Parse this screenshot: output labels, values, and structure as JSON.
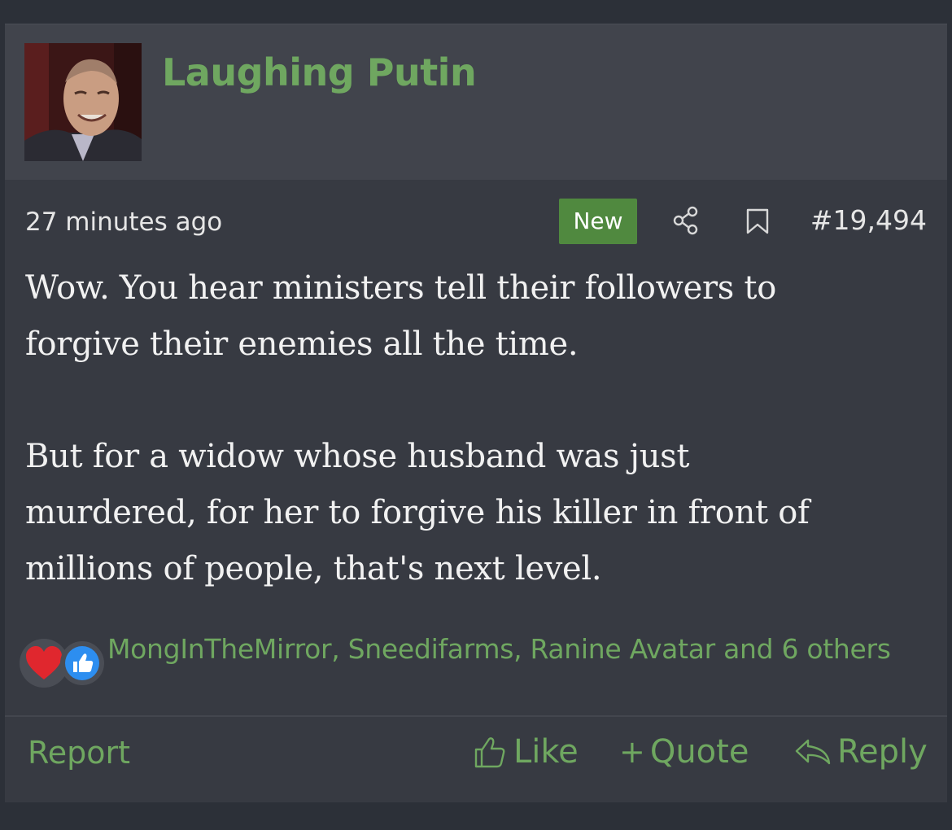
{
  "user": {
    "name": "Laughing Putin",
    "avatar_icon": "user-avatar-photo"
  },
  "meta": {
    "timestamp": "27 minutes ago",
    "badge": "New",
    "post_number": "#19,494",
    "share_icon": "share-icon",
    "bookmark_icon": "bookmark-icon"
  },
  "message": {
    "paragraph1": [
      "Wow. You hear ministers tell their followers to",
      "forgive their enemies all the time."
    ],
    "paragraph2": [
      "But for a widow whose husband was just",
      "murdered, for her to forgive his killer in front of",
      "millions of people, that's next level."
    ]
  },
  "reactions": {
    "icons": [
      "heart-icon",
      "thumbs-up-icon"
    ],
    "text": "MongInTheMirror, Sneedifarms, Ranine Avatar and 6 others"
  },
  "footer": {
    "report_label": "Report",
    "like_label": "Like",
    "quote_label": "Quote",
    "reply_label": "Reply"
  },
  "colors": {
    "accent_green": "#6fa760",
    "badge_green": "#50893f",
    "post_bg": "#373a42",
    "header_bg": "#41444c",
    "page_bg": "#2c3038"
  }
}
